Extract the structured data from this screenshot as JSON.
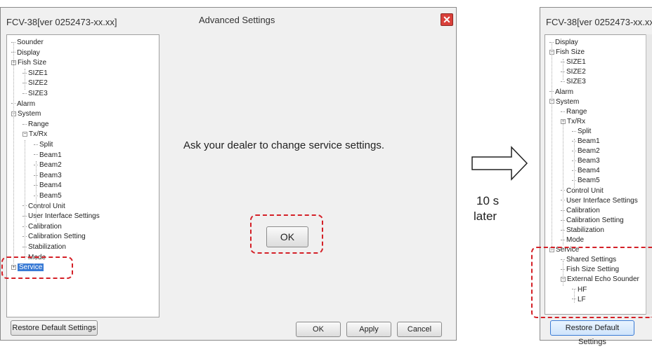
{
  "left_window": {
    "app_title": "FCV-38[ver 0252473-xx.xx]",
    "dialog_title": "Advanced Settings",
    "close_glyph": "✕",
    "tree": [
      {
        "label": "Sounder"
      },
      {
        "label": "Display"
      },
      {
        "label": "Fish Size",
        "expander": "−"
      },
      {
        "label": "SIZE1"
      },
      {
        "label": "SIZE2"
      },
      {
        "label": "SIZE3"
      },
      {
        "label": "Alarm"
      },
      {
        "label": "System",
        "expander": "−"
      },
      {
        "label": "Range"
      },
      {
        "label": "Tx/Rx",
        "expander": "−"
      },
      {
        "label": "Split"
      },
      {
        "label": "Beam1"
      },
      {
        "label": "Beam2"
      },
      {
        "label": "Beam3"
      },
      {
        "label": "Beam4"
      },
      {
        "label": "Beam5"
      },
      {
        "label": "Control Unit"
      },
      {
        "label": "User Interface Settings"
      },
      {
        "label": "Calibration"
      },
      {
        "label": "Calibration Setting"
      },
      {
        "label": "Stabilization"
      },
      {
        "label": "Mode"
      },
      {
        "label": "Service",
        "expander": "+",
        "selected": true
      }
    ],
    "message": "Ask your dealer to change service settings.",
    "ok_center_label": "OK",
    "restore_label": "Restore Default Settings",
    "ok_label": "OK",
    "apply_label": "Apply",
    "cancel_label": "Cancel"
  },
  "transition": {
    "line1": "10 s",
    "line2": "later",
    "arrow_icon": "outline-arrow-right"
  },
  "right_window": {
    "app_title": "FCV-38[ver 0252473-xx.xx",
    "tree": [
      {
        "label": "Display"
      },
      {
        "label": "Fish Size",
        "expander": "−"
      },
      {
        "label": "SIZE1"
      },
      {
        "label": "SIZE2"
      },
      {
        "label": "SIZE3"
      },
      {
        "label": "Alarm"
      },
      {
        "label": "System",
        "expander": "−"
      },
      {
        "label": "Range"
      },
      {
        "label": "Tx/Rx",
        "expander": "−"
      },
      {
        "label": "Split"
      },
      {
        "label": "Beam1"
      },
      {
        "label": "Beam2"
      },
      {
        "label": "Beam3"
      },
      {
        "label": "Beam4"
      },
      {
        "label": "Beam5"
      },
      {
        "label": "Control Unit"
      },
      {
        "label": "User Interface Settings"
      },
      {
        "label": "Calibration"
      },
      {
        "label": "Calibration Setting"
      },
      {
        "label": "Stabilization"
      },
      {
        "label": "Mode"
      },
      {
        "label": "Service",
        "expander": "−"
      },
      {
        "label": "Shared Settings"
      },
      {
        "label": "Fish Size Setting"
      },
      {
        "label": "External Echo Sounder",
        "expander": "−"
      },
      {
        "label": "HF"
      },
      {
        "label": "LF"
      }
    ],
    "restore_label": "Restore Default Settings"
  },
  "colors": {
    "highlight_dashed": "#d42027",
    "selection": "#3a7bd5",
    "close_button": "#d9403a"
  }
}
